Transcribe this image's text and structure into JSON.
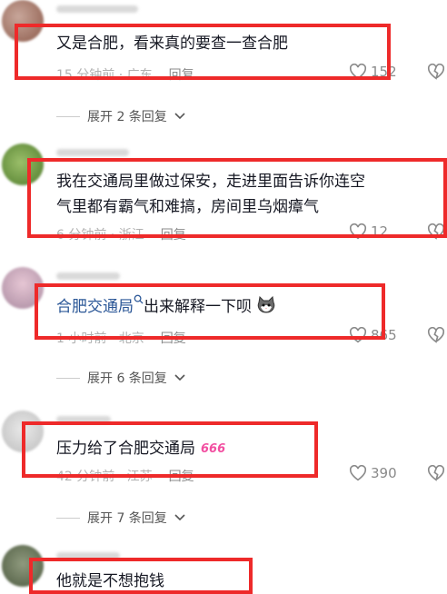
{
  "comments": [
    {
      "text": "又是合肥，看来真的要查一查合肥",
      "time": "15 分钟前 · 广东",
      "reply": "回复",
      "likes": "152",
      "expand": "展开 2 条回复"
    },
    {
      "text_line1": "我在交通局里做过保安，走进里面告诉你连空",
      "text_line2": "气里都有霸气和难搞，房间里乌烟瘴气",
      "time": "6 分钟前 · 浙江",
      "reply": "回复",
      "likes": "12"
    },
    {
      "mention": "合肥交通局",
      "text": "出来解释一下呗",
      "time": "1 小时前 · 北京",
      "reply": "回复",
      "likes": "865",
      "expand": "展开 6 条回复"
    },
    {
      "text": "压力给了合肥交通局",
      "time": "42 分钟前 · 江苏",
      "reply": "回复",
      "likes": "390",
      "expand": "展开 7 条回复"
    },
    {
      "text": "他就是不想抱钱"
    }
  ],
  "colors": {
    "highlight_border": "#ee2a2a",
    "mention": "#2b5797",
    "meta": "#b0b0b0"
  },
  "icons": {
    "like": "heart-outline-icon",
    "dislike": "broken-heart-icon",
    "expand": "chevron-down-icon",
    "search": "search-icon",
    "emoji_cat": "cat-face-emoji",
    "emoji_666": "666-sticker"
  }
}
